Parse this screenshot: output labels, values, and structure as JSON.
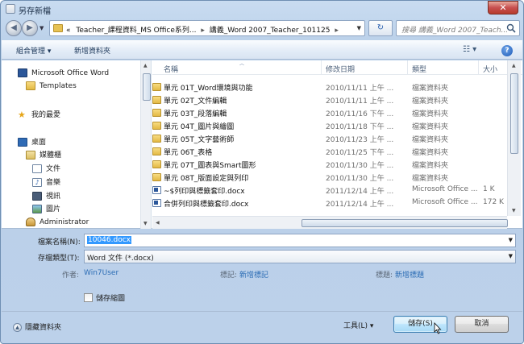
{
  "window": {
    "title": "另存新檔",
    "close_glyph": "✕"
  },
  "nav": {
    "back_glyph": "◀",
    "fwd_glyph": "▶",
    "address_prefix": "«",
    "address_segments": [
      "Teacher_課程資料_MS Office系列...",
      "講義_Word 2007_Teacher_101125"
    ],
    "address_sep": "▸",
    "refresh_glyph": "↻",
    "search_placeholder": "搜尋 講義_Word 2007_Teach..."
  },
  "toolbar": {
    "organize": "組合管理 ▾",
    "new_folder": "新增資料夾",
    "view_glyph": "☷ ▾",
    "help_glyph": "?"
  },
  "navpane": {
    "items": [
      {
        "label": "Microsoft Office Word",
        "icon": "word-icon"
      },
      {
        "label": "Templates",
        "icon": "folder-icon"
      },
      {
        "label": "我的最愛",
        "icon": "star-icon"
      },
      {
        "label": "桌面",
        "icon": "desktop-icon"
      },
      {
        "label": "媒體櫃",
        "icon": "library-icon"
      },
      {
        "label": "文件",
        "icon": "documents-icon"
      },
      {
        "label": "音樂",
        "icon": "music-icon"
      },
      {
        "label": "視訊",
        "icon": "video-icon"
      },
      {
        "label": "圖片",
        "icon": "pictures-icon"
      },
      {
        "label": "Administrator",
        "icon": "user-icon"
      }
    ]
  },
  "files": {
    "headers": {
      "name": "名稱",
      "date": "修改日期",
      "type": "類型",
      "size": "大小"
    },
    "rows": [
      {
        "name": "單元 01T_Word環境與功能",
        "date": "2010/11/11 上午 ...",
        "type": "檔案資料夾",
        "size": "",
        "kind": "folder"
      },
      {
        "name": "單元 02T_文件編輯",
        "date": "2010/11/11 上午 ...",
        "type": "檔案資料夾",
        "size": "",
        "kind": "folder"
      },
      {
        "name": "單元 03T_段落編輯",
        "date": "2010/11/16 下午 ...",
        "type": "檔案資料夾",
        "size": "",
        "kind": "folder"
      },
      {
        "name": "單元 04T_圖片與繪圖",
        "date": "2010/11/18 下午 ...",
        "type": "檔案資料夾",
        "size": "",
        "kind": "folder"
      },
      {
        "name": "單元 05T_文字藝術師",
        "date": "2010/11/23 上午 ...",
        "type": "檔案資料夾",
        "size": "",
        "kind": "folder"
      },
      {
        "name": "單元 06T_表格",
        "date": "2010/11/25 下午 ...",
        "type": "檔案資料夾",
        "size": "",
        "kind": "folder"
      },
      {
        "name": "單元 07T_圖表與Smart圖形",
        "date": "2010/11/30 上午 ...",
        "type": "檔案資料夾",
        "size": "",
        "kind": "folder"
      },
      {
        "name": "單元 08T_版面設定與列印",
        "date": "2010/11/30 上午 ...",
        "type": "檔案資料夾",
        "size": "",
        "kind": "folder"
      },
      {
        "name": "~$列印與標籤套印.docx",
        "date": "2011/12/14 上午 ...",
        "type": "Microsoft Office ...",
        "size": "1 K",
        "kind": "docx"
      },
      {
        "name": "合併列印與標籤套印.docx",
        "date": "2011/12/14 上午 ...",
        "type": "Microsoft Office ...",
        "size": "172 K",
        "kind": "docx"
      }
    ]
  },
  "form": {
    "filename_label": "檔案名稱(N):",
    "filename_value": "10046.docx",
    "type_label": "存檔類型(T):",
    "type_value": "Word 文件 (*.docx)",
    "author_label": "作者:",
    "author_value": "Win7User",
    "tags_label": "標記:",
    "tags_value": "新增標記",
    "title_label": "標題:",
    "title_value": "新增標題",
    "thumbnail_label": "儲存縮圖"
  },
  "footer": {
    "hide_folders": "隱藏資料夾",
    "tools": "工具(L)  ▾",
    "save": "儲存(S)",
    "cancel": "取消"
  }
}
